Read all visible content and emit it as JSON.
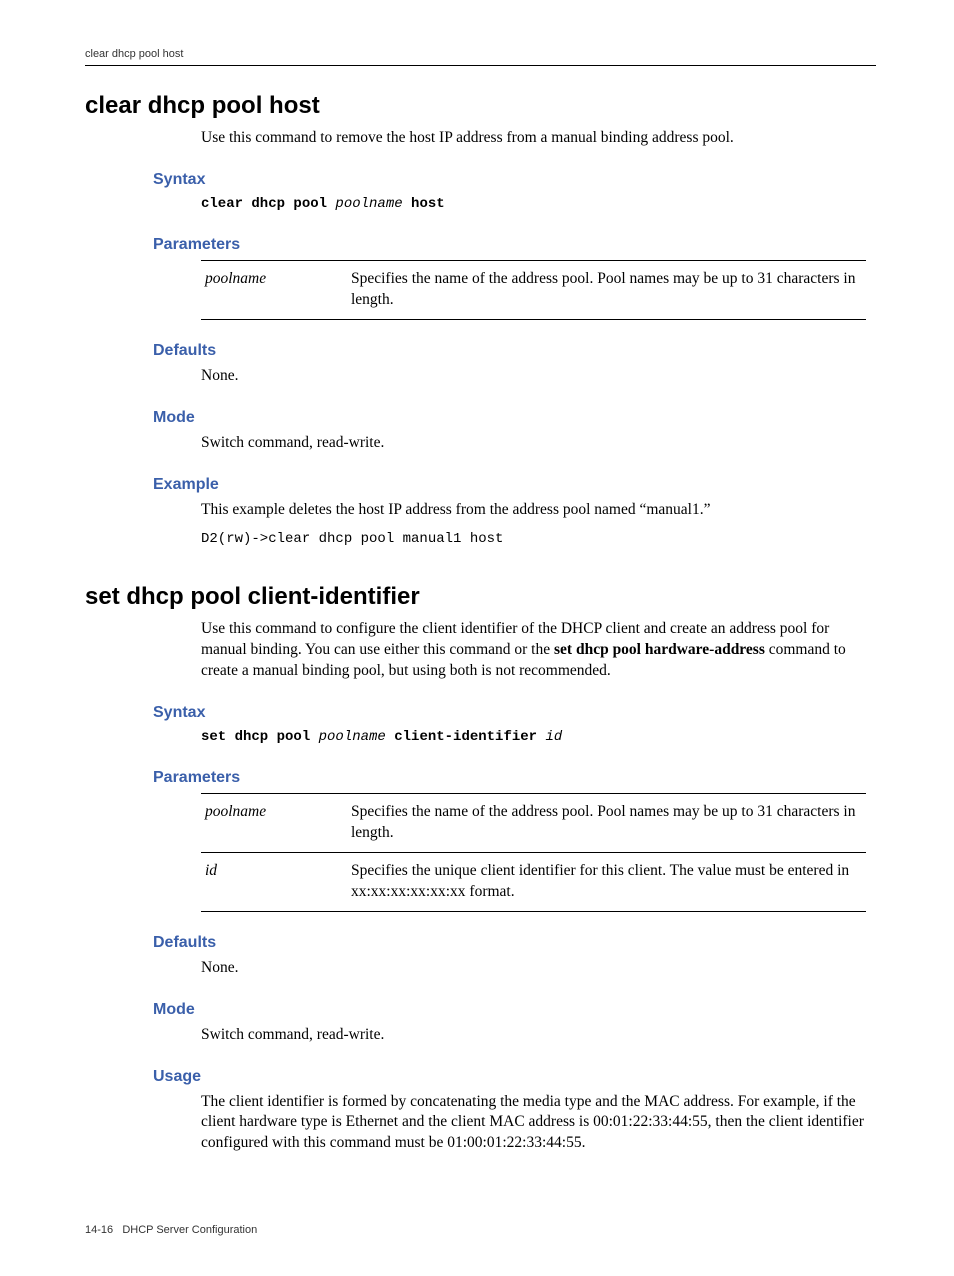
{
  "running_head": "clear dhcp pool host",
  "cmd1": {
    "title": "clear dhcp pool host",
    "intro": "Use this command to remove the host IP address from a manual binding address pool.",
    "syntax_heading": "Syntax",
    "syntax_pre": "clear dhcp pool ",
    "syntax_var": "poolname",
    "syntax_post": " host",
    "params_heading": "Parameters",
    "params": [
      {
        "name": "poolname",
        "desc": "Specifies the name of the address pool. Pool names may be up to 31 characters in length."
      }
    ],
    "defaults_heading": "Defaults",
    "defaults_text": "None.",
    "mode_heading": "Mode",
    "mode_text": "Switch command, read‑write.",
    "example_heading": "Example",
    "example_text": "This example deletes the host IP address from the address pool named “manual1.”",
    "example_code": "D2(rw)->clear dhcp pool manual1 host"
  },
  "cmd2": {
    "title": "set dhcp pool client-identifier",
    "intro_pre": "Use this command to configure the client identifier of the DHCP client and create an address pool for manual binding. You can use either this command or the ",
    "intro_bold": "set dhcp pool hardware‑address",
    "intro_post": " command to create a manual binding pool, but using both is not recommended.",
    "syntax_heading": "Syntax",
    "syntax_s1": "set dhcp pool ",
    "syntax_v1": "poolname",
    "syntax_s2": " client-identifier ",
    "syntax_v2": "id",
    "params_heading": "Parameters",
    "params": [
      {
        "name": "poolname",
        "desc": "Specifies the name of the address pool. Pool names may be up to 31 characters in length."
      },
      {
        "name": "id",
        "desc": "Specifies the unique client identifier for this client. The value must be entered in xx:xx:xx:xx:xx:xx format."
      }
    ],
    "defaults_heading": "Defaults",
    "defaults_text": "None.",
    "mode_heading": "Mode",
    "mode_text": "Switch command, read‑write.",
    "usage_heading": "Usage",
    "usage_text": "The client identifier is formed by concatenating the media type and the MAC address. For example, if the client hardware type is Ethernet and the client MAC address is 00:01:22:33:44:55, then the client identifier configured with this command must be 01:00:01:22:33:44:55."
  },
  "footer_page": "14-16",
  "footer_title": "DHCP Server Configuration"
}
